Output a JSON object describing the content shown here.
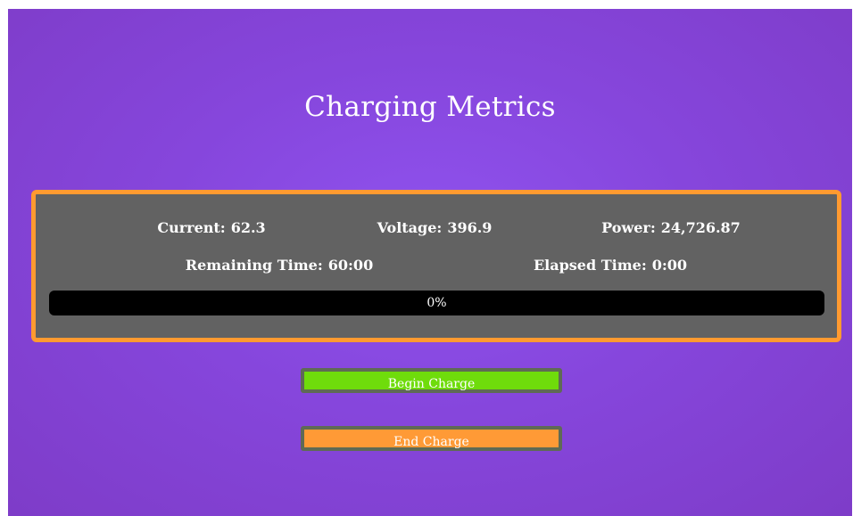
{
  "page": {
    "title": "Charging Metrics"
  },
  "metrics": {
    "current_label": "Current:",
    "current_value": "62.3",
    "voltage_label": "Voltage:",
    "voltage_value": "396.9",
    "power_label": "Power:",
    "power_value": "24,726.87",
    "remaining_label": "Remaining Time:",
    "remaining_value": "60:00",
    "elapsed_label": "Elapsed Time:",
    "elapsed_value": "0:00"
  },
  "progress": {
    "text": "0%",
    "fraction": 0
  },
  "buttons": {
    "begin_label": "Begin Charge",
    "end_label": "End Charge"
  },
  "colors": {
    "background": "#8646dc",
    "panel": "#626262",
    "panel_border": "#ff9a30",
    "progress_track": "#000000",
    "begin_button": "#6fdc0b",
    "end_button": "#ff9a36"
  }
}
